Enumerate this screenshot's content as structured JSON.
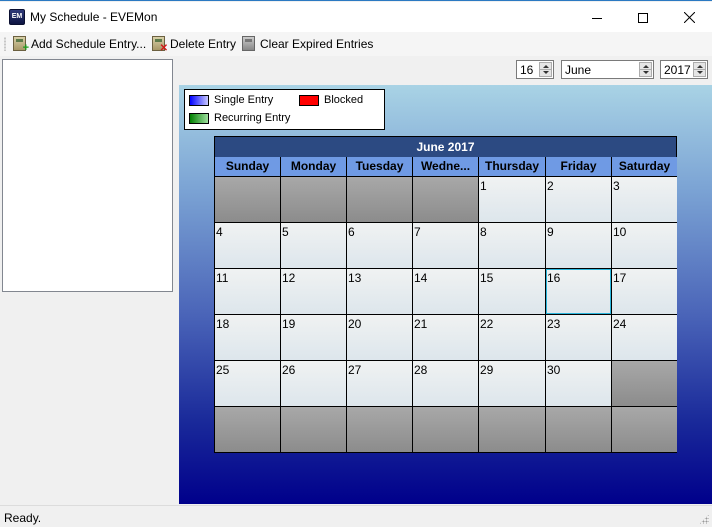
{
  "window": {
    "title": "My Schedule - EVEMon",
    "app_icon_text": "EM",
    "controls": {
      "minimize": "minimize-icon",
      "maximize": "maximize-icon",
      "close": "close-icon"
    }
  },
  "toolbar": {
    "add_label": "Add Schedule Entry...",
    "delete_label": "Delete Entry",
    "clear_label": "Clear Expired Entries"
  },
  "date_pickers": {
    "day": "16",
    "month": "June",
    "year": "2017"
  },
  "legend": {
    "single": {
      "label": "Single Entry",
      "color_from": "#0000ff",
      "color_to": "#c8c8ff"
    },
    "blocked": {
      "label": "Blocked",
      "color": "#ff0000"
    },
    "recurring": {
      "label": "Recurring Entry",
      "color_from": "#008000",
      "color_to": "#a0e0a0"
    }
  },
  "calendar": {
    "title": "June 2017",
    "weekdays": [
      "Sunday",
      "Monday",
      "Tuesday",
      "Wedne...",
      "Thursday",
      "Friday",
      "Saturday"
    ],
    "selected_day": "16",
    "cells": [
      "",
      "",
      "",
      "",
      "1",
      "2",
      "3",
      "4",
      "5",
      "6",
      "7",
      "8",
      "9",
      "10",
      "11",
      "12",
      "13",
      "14",
      "15",
      "16",
      "17",
      "18",
      "19",
      "20",
      "21",
      "22",
      "23",
      "24",
      "25",
      "26",
      "27",
      "28",
      "29",
      "30",
      "",
      "",
      "",
      "",
      "",
      "",
      "",
      ""
    ]
  },
  "status": {
    "text": "Ready."
  }
}
